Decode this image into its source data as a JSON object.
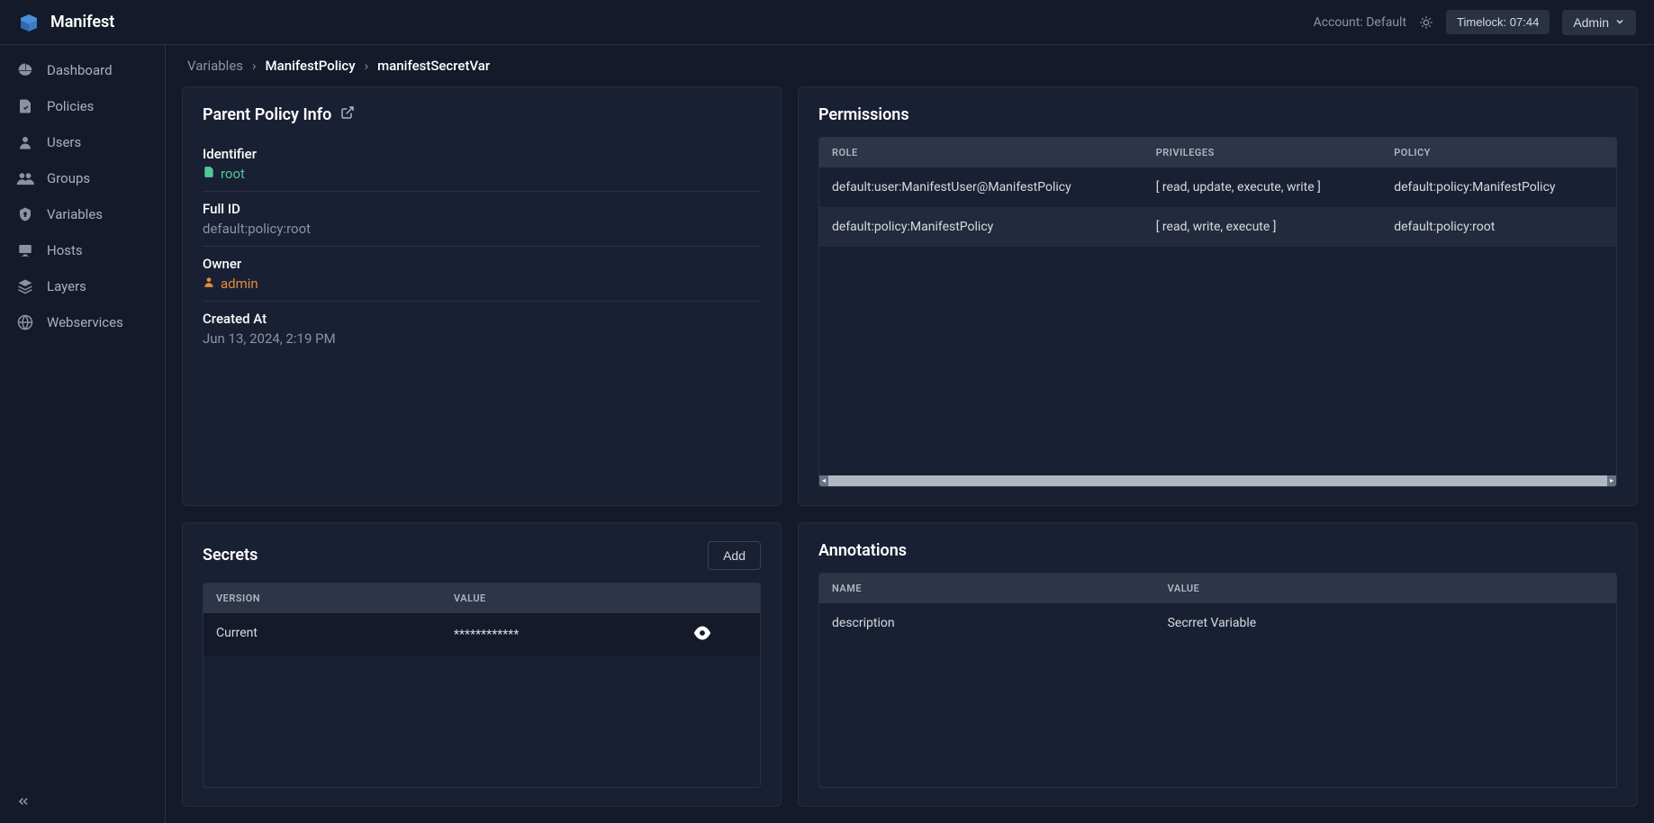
{
  "app": {
    "name": "Manifest"
  },
  "topbar": {
    "account_label": "Account: Default",
    "timelock_label": "Timelock: 07:44",
    "user_label": "Admin"
  },
  "sidebar": {
    "items": [
      {
        "label": "Dashboard"
      },
      {
        "label": "Policies"
      },
      {
        "label": "Users"
      },
      {
        "label": "Groups"
      },
      {
        "label": "Variables"
      },
      {
        "label": "Hosts"
      },
      {
        "label": "Layers"
      },
      {
        "label": "Webservices"
      }
    ]
  },
  "breadcrumb": {
    "a": "Variables",
    "b": "ManifestPolicy",
    "c": "manifestSecretVar"
  },
  "parent_policy": {
    "title": "Parent Policy Info",
    "identifier_label": "Identifier",
    "identifier_value": "root",
    "fullid_label": "Full ID",
    "fullid_value": "default:policy:root",
    "owner_label": "Owner",
    "owner_value": "admin",
    "created_label": "Created At",
    "created_value": "Jun 13, 2024, 2:19 PM"
  },
  "permissions": {
    "title": "Permissions",
    "headers": {
      "role": "ROLE",
      "priv": "PRIVILEGES",
      "pol": "POLICY"
    },
    "rows": [
      {
        "role": "default:user:ManifestUser@ManifestPolicy",
        "priv": "[ read, update, execute, write ]",
        "pol": "default:policy:ManifestPolicy"
      },
      {
        "role": "default:policy:ManifestPolicy",
        "priv": "[ read, write, execute ]",
        "pol": "default:policy:root"
      }
    ]
  },
  "secrets": {
    "title": "Secrets",
    "add_label": "Add",
    "headers": {
      "version": "VERSION",
      "value": "VALUE"
    },
    "rows": [
      {
        "version": "Current",
        "value": "************"
      }
    ]
  },
  "annotations": {
    "title": "Annotations",
    "headers": {
      "name": "NAME",
      "value": "VALUE"
    },
    "rows": [
      {
        "name": "description",
        "value": "Secrret Variable"
      }
    ]
  }
}
